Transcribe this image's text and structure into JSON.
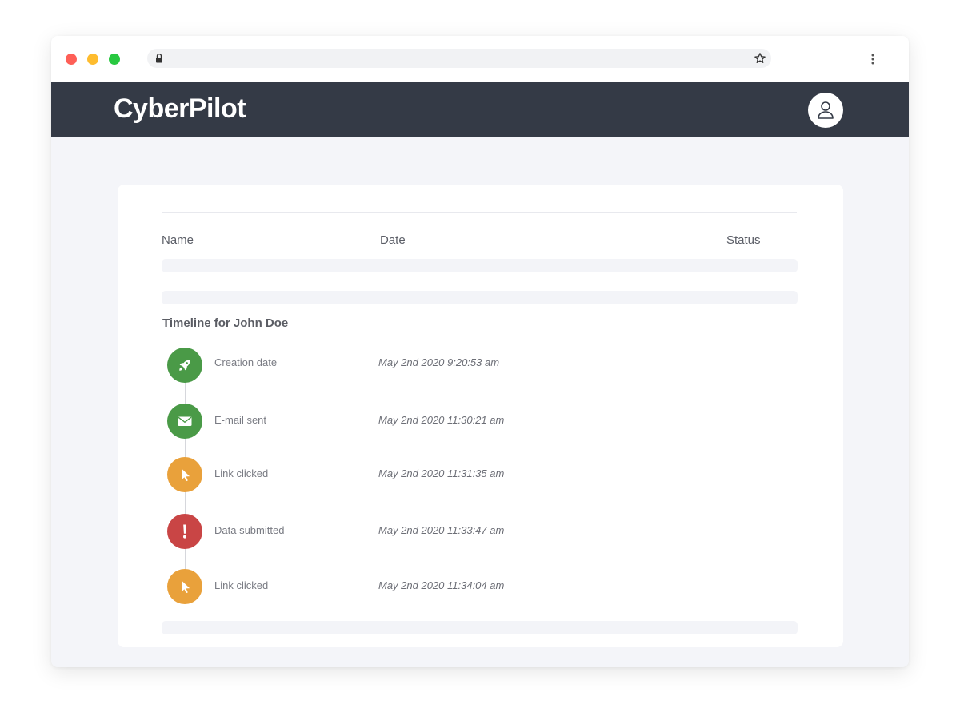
{
  "window": {
    "controls": [
      {
        "name": "close",
        "color": "#fe5f57"
      },
      {
        "name": "minimize",
        "color": "#febc2e"
      },
      {
        "name": "maximize",
        "color": "#28c840"
      }
    ],
    "url": "",
    "icons": {
      "lock": "lock-icon",
      "star": "star-icon",
      "menu": "kebab-menu-icon"
    }
  },
  "header": {
    "logo": "CyberPilot",
    "background": "#343a46",
    "account_icon": "user-icon"
  },
  "table": {
    "columns": [
      "Name",
      "Date",
      "Status"
    ]
  },
  "timeline": {
    "title": "Timeline for John Doe",
    "events": [
      {
        "label": "Creation date",
        "date": "May 2nd 2020 9:20:53 am",
        "icon": "rocket-icon",
        "color": "#4a9a47"
      },
      {
        "label": "E-mail sent",
        "date": "May 2nd 2020 11:30:21 am",
        "icon": "envelope-icon",
        "color": "#4a9a47"
      },
      {
        "label": "Link clicked",
        "date": "May 2nd 2020 11:31:35 am",
        "icon": "cursor-icon",
        "color": "#e9a13b"
      },
      {
        "label": "Data submitted",
        "date": "May 2nd 2020 11:33:47 am",
        "icon": "exclamation-icon",
        "color": "#c94545"
      },
      {
        "label": "Link clicked",
        "date": "May 2nd 2020 11:34:04 am",
        "icon": "cursor-icon",
        "color": "#e9a13b"
      }
    ]
  }
}
